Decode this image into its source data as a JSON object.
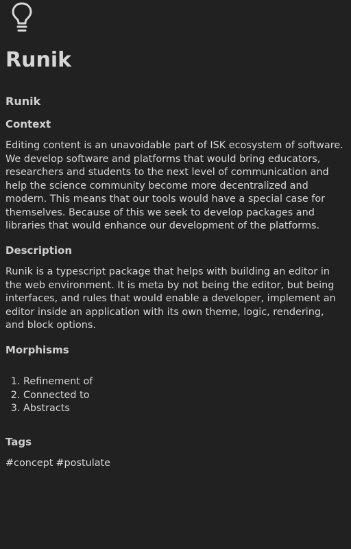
{
  "logo": {
    "icon": "lightbulb-icon",
    "color": "#d8d8d8"
  },
  "title": "Runik",
  "subtitle": "Runik",
  "sections": {
    "context": {
      "heading": "Context",
      "body": "Editing content is an unavoidable part of ISK ecosystem of software. We develop software and platforms that would bring educators, researchers and students to the next level of communication and help the science community become more decentralized and modern. This means that our tools would have a special case for themselves. Because of this we seek to develop packages and libraries that would enhance our development of the platforms."
    },
    "description": {
      "heading": "Description",
      "body": "Runik is a typescript package that helps with building an editor in the web environment. It is meta by not being the editor, but being interfaces, and rules that would enable a developer, implement an editor inside an application with its own theme, logic, rendering, and block options."
    },
    "morphisms": {
      "heading": "Morphisms",
      "items": [
        "Refinement of",
        "Connected to",
        "Abstracts"
      ]
    },
    "tags": {
      "heading": "Tags",
      "items": [
        "#concept",
        "#postulate"
      ]
    }
  },
  "colors": {
    "background": "#212121",
    "text": "#d8d8d8"
  }
}
